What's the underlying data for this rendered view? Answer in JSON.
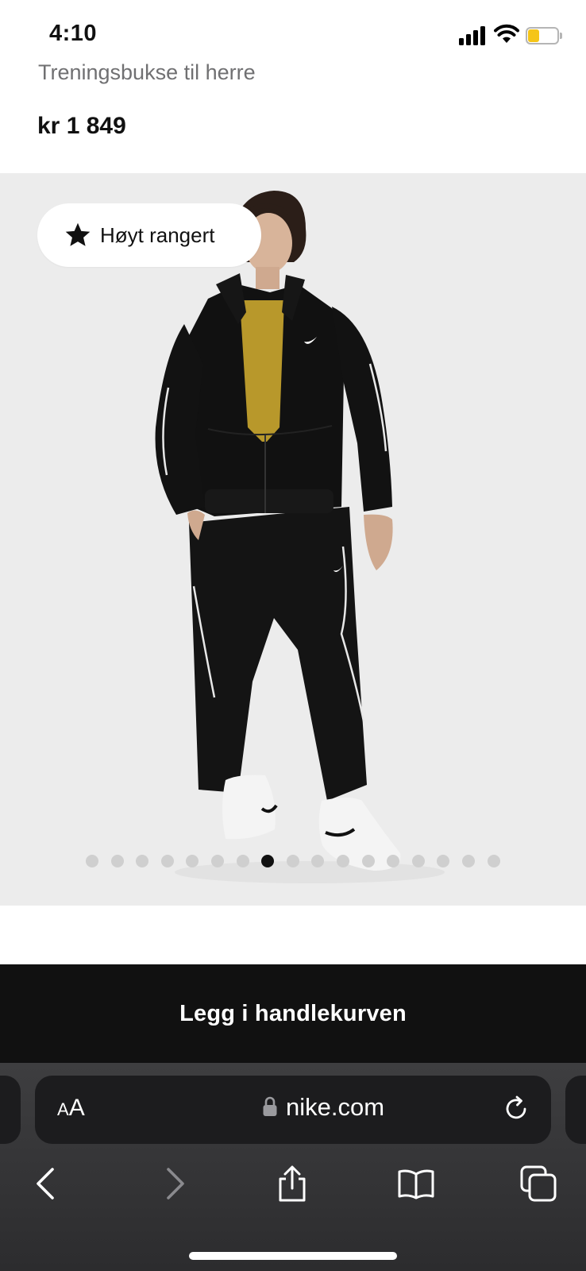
{
  "status_bar": {
    "time": "4:10",
    "signal_icon": "cellular-signal-icon",
    "wifi_icon": "wifi-icon",
    "battery_icon": "battery-icon",
    "battery_level": 0.4,
    "battery_color": "#f5c518"
  },
  "product": {
    "subtitle": "Treningsbukse til herre",
    "price": "kr 1 849"
  },
  "gallery": {
    "badge": {
      "icon": "star-icon",
      "label": "Høyt rangert"
    },
    "dot_count": 17,
    "active_dot_index": 7
  },
  "cart": {
    "button_label": "Legg i handlekurven",
    "button_color": "#111111"
  },
  "browser": {
    "text_size_small": "A",
    "text_size_big": "A",
    "lock_icon": "lock-icon",
    "url": "nike.com",
    "reload_icon": "reload-icon",
    "toolbar": [
      "back-icon",
      "forward-icon",
      "share-icon",
      "bookmarks-icon",
      "tabs-icon"
    ]
  }
}
